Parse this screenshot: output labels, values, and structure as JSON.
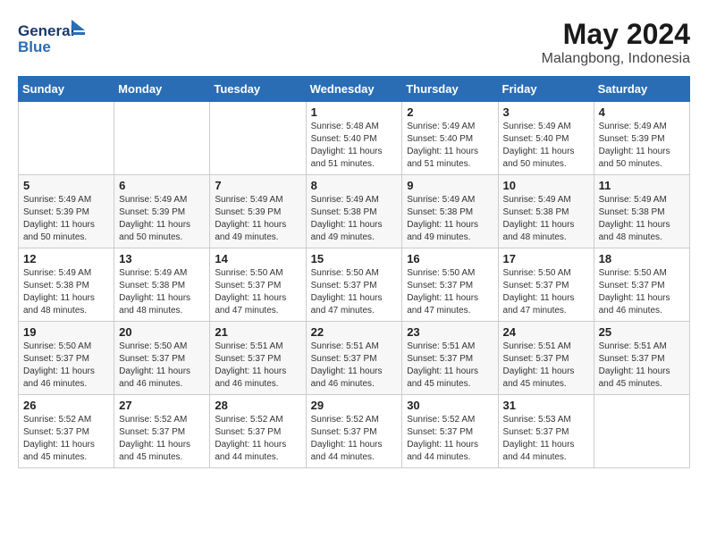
{
  "header": {
    "logo_line1": "General",
    "logo_line2": "Blue",
    "month_year": "May 2024",
    "location": "Malangbong, Indonesia"
  },
  "days_of_week": [
    "Sunday",
    "Monday",
    "Tuesday",
    "Wednesday",
    "Thursday",
    "Friday",
    "Saturday"
  ],
  "weeks": [
    [
      {
        "day": "",
        "info": ""
      },
      {
        "day": "",
        "info": ""
      },
      {
        "day": "",
        "info": ""
      },
      {
        "day": "1",
        "info": "Sunrise: 5:48 AM\nSunset: 5:40 PM\nDaylight: 11 hours\nand 51 minutes."
      },
      {
        "day": "2",
        "info": "Sunrise: 5:49 AM\nSunset: 5:40 PM\nDaylight: 11 hours\nand 51 minutes."
      },
      {
        "day": "3",
        "info": "Sunrise: 5:49 AM\nSunset: 5:40 PM\nDaylight: 11 hours\nand 50 minutes."
      },
      {
        "day": "4",
        "info": "Sunrise: 5:49 AM\nSunset: 5:39 PM\nDaylight: 11 hours\nand 50 minutes."
      }
    ],
    [
      {
        "day": "5",
        "info": "Sunrise: 5:49 AM\nSunset: 5:39 PM\nDaylight: 11 hours\nand 50 minutes."
      },
      {
        "day": "6",
        "info": "Sunrise: 5:49 AM\nSunset: 5:39 PM\nDaylight: 11 hours\nand 50 minutes."
      },
      {
        "day": "7",
        "info": "Sunrise: 5:49 AM\nSunset: 5:39 PM\nDaylight: 11 hours\nand 49 minutes."
      },
      {
        "day": "8",
        "info": "Sunrise: 5:49 AM\nSunset: 5:38 PM\nDaylight: 11 hours\nand 49 minutes."
      },
      {
        "day": "9",
        "info": "Sunrise: 5:49 AM\nSunset: 5:38 PM\nDaylight: 11 hours\nand 49 minutes."
      },
      {
        "day": "10",
        "info": "Sunrise: 5:49 AM\nSunset: 5:38 PM\nDaylight: 11 hours\nand 48 minutes."
      },
      {
        "day": "11",
        "info": "Sunrise: 5:49 AM\nSunset: 5:38 PM\nDaylight: 11 hours\nand 48 minutes."
      }
    ],
    [
      {
        "day": "12",
        "info": "Sunrise: 5:49 AM\nSunset: 5:38 PM\nDaylight: 11 hours\nand 48 minutes."
      },
      {
        "day": "13",
        "info": "Sunrise: 5:49 AM\nSunset: 5:38 PM\nDaylight: 11 hours\nand 48 minutes."
      },
      {
        "day": "14",
        "info": "Sunrise: 5:50 AM\nSunset: 5:37 PM\nDaylight: 11 hours\nand 47 minutes."
      },
      {
        "day": "15",
        "info": "Sunrise: 5:50 AM\nSunset: 5:37 PM\nDaylight: 11 hours\nand 47 minutes."
      },
      {
        "day": "16",
        "info": "Sunrise: 5:50 AM\nSunset: 5:37 PM\nDaylight: 11 hours\nand 47 minutes."
      },
      {
        "day": "17",
        "info": "Sunrise: 5:50 AM\nSunset: 5:37 PM\nDaylight: 11 hours\nand 47 minutes."
      },
      {
        "day": "18",
        "info": "Sunrise: 5:50 AM\nSunset: 5:37 PM\nDaylight: 11 hours\nand 46 minutes."
      }
    ],
    [
      {
        "day": "19",
        "info": "Sunrise: 5:50 AM\nSunset: 5:37 PM\nDaylight: 11 hours\nand 46 minutes."
      },
      {
        "day": "20",
        "info": "Sunrise: 5:50 AM\nSunset: 5:37 PM\nDaylight: 11 hours\nand 46 minutes."
      },
      {
        "day": "21",
        "info": "Sunrise: 5:51 AM\nSunset: 5:37 PM\nDaylight: 11 hours\nand 46 minutes."
      },
      {
        "day": "22",
        "info": "Sunrise: 5:51 AM\nSunset: 5:37 PM\nDaylight: 11 hours\nand 46 minutes."
      },
      {
        "day": "23",
        "info": "Sunrise: 5:51 AM\nSunset: 5:37 PM\nDaylight: 11 hours\nand 45 minutes."
      },
      {
        "day": "24",
        "info": "Sunrise: 5:51 AM\nSunset: 5:37 PM\nDaylight: 11 hours\nand 45 minutes."
      },
      {
        "day": "25",
        "info": "Sunrise: 5:51 AM\nSunset: 5:37 PM\nDaylight: 11 hours\nand 45 minutes."
      }
    ],
    [
      {
        "day": "26",
        "info": "Sunrise: 5:52 AM\nSunset: 5:37 PM\nDaylight: 11 hours\nand 45 minutes."
      },
      {
        "day": "27",
        "info": "Sunrise: 5:52 AM\nSunset: 5:37 PM\nDaylight: 11 hours\nand 45 minutes."
      },
      {
        "day": "28",
        "info": "Sunrise: 5:52 AM\nSunset: 5:37 PM\nDaylight: 11 hours\nand 44 minutes."
      },
      {
        "day": "29",
        "info": "Sunrise: 5:52 AM\nSunset: 5:37 PM\nDaylight: 11 hours\nand 44 minutes."
      },
      {
        "day": "30",
        "info": "Sunrise: 5:52 AM\nSunset: 5:37 PM\nDaylight: 11 hours\nand 44 minutes."
      },
      {
        "day": "31",
        "info": "Sunrise: 5:53 AM\nSunset: 5:37 PM\nDaylight: 11 hours\nand 44 minutes."
      },
      {
        "day": "",
        "info": ""
      }
    ]
  ]
}
